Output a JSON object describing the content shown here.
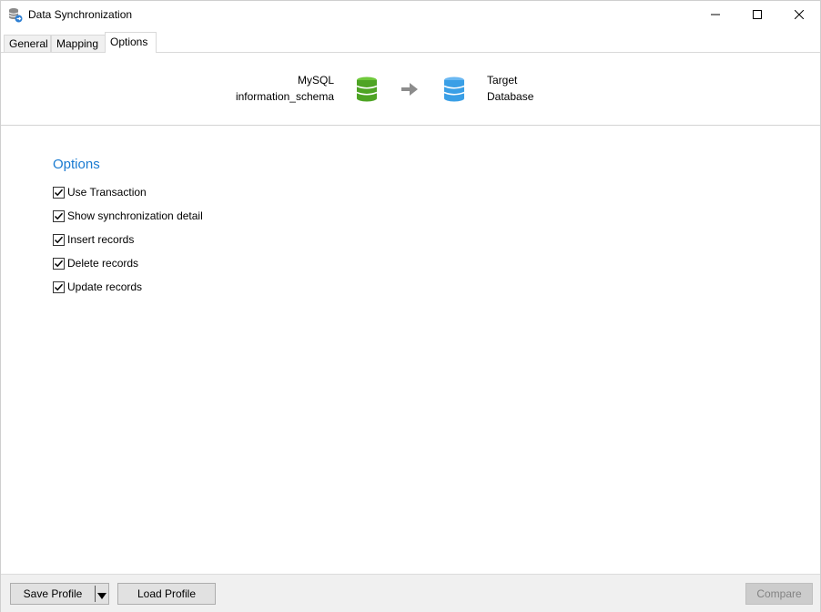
{
  "window": {
    "title": "Data Synchronization"
  },
  "tabs": [
    {
      "label": "General",
      "active": false
    },
    {
      "label": "Mapping",
      "active": false
    },
    {
      "label": "Options",
      "active": true
    }
  ],
  "header": {
    "source_line1": "MySQL",
    "source_line2": "information_schema",
    "target_line1": "Target",
    "target_line2": "Database",
    "source_icon": "database-green-icon",
    "target_icon": "database-blue-icon",
    "arrow_icon": "arrow-right-icon"
  },
  "options": {
    "title": "Options",
    "items": [
      {
        "label": "Use Transaction",
        "checked": true
      },
      {
        "label": "Show synchronization detail",
        "checked": true
      },
      {
        "label": "Insert records",
        "checked": true
      },
      {
        "label": "Delete records",
        "checked": true
      },
      {
        "label": "Update records",
        "checked": true
      }
    ]
  },
  "footer": {
    "save_label": "Save Profile",
    "load_label": "Load Profile",
    "compare_label": "Compare",
    "compare_enabled": false
  },
  "colors": {
    "accent": "#1a7bd1",
    "source_db": "#5cb82e",
    "target_db": "#3a9fe6"
  }
}
